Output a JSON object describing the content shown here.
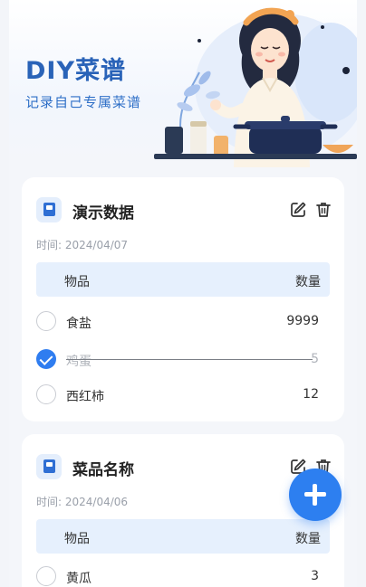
{
  "header": {
    "title": "DIY菜谱",
    "subtitle": "记录自己专属菜谱"
  },
  "table_header": {
    "item": "物品",
    "qty": "数量"
  },
  "recipes": [
    {
      "name": "演示数据",
      "date": "时间: 2024/04/07",
      "items": [
        {
          "name": "食盐",
          "qty": "9999",
          "checked": false
        },
        {
          "name": "鸡蛋",
          "qty": "5",
          "checked": true
        },
        {
          "name": "西红柿",
          "qty": "12",
          "checked": false
        }
      ]
    },
    {
      "name": "菜品名称",
      "date": "时间: 2024/04/06",
      "items": [
        {
          "name": "黄瓜",
          "qty": "3",
          "checked": false
        }
      ]
    }
  ],
  "icons": {
    "recipe": "recipe-book-icon",
    "edit": "edit-icon",
    "delete": "trash-icon",
    "add": "plus-icon",
    "check": "checkmark-icon"
  },
  "colors": {
    "brand": "#2a63b8",
    "accent": "#2d7ff0",
    "table_header_bg": "#e6f0fd"
  }
}
